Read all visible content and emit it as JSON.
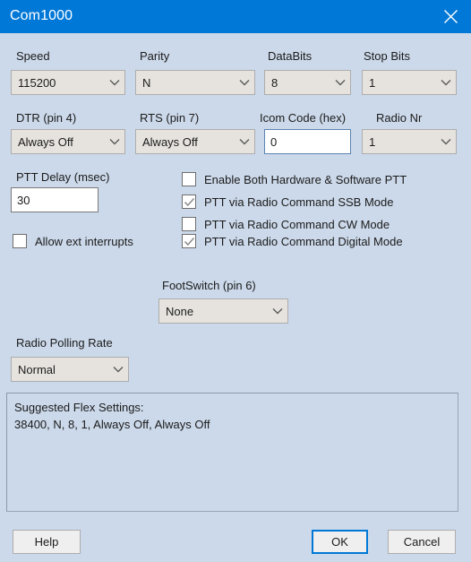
{
  "window": {
    "title": "Com1000",
    "close_icon": "close-icon",
    "titlebar_color": "#0078d7",
    "background_color": "#ccd9ea"
  },
  "fields": {
    "speed": {
      "label": "Speed",
      "value": "115200"
    },
    "parity": {
      "label": "Parity",
      "value": "N"
    },
    "databits": {
      "label": "DataBits",
      "value": "8"
    },
    "stopbits": {
      "label": "Stop Bits",
      "value": "1"
    },
    "dtr": {
      "label": "DTR (pin 4)",
      "value": "Always Off"
    },
    "rts": {
      "label": "RTS (pin 7)",
      "value": "Always Off"
    },
    "icom_code": {
      "label": "Icom Code (hex)",
      "value": "0"
    },
    "radio_nr": {
      "label": "Radio Nr",
      "value": "1"
    },
    "ptt_delay": {
      "label": "PTT Delay  (msec)",
      "value": "30"
    },
    "footswitch": {
      "label": "FootSwitch (pin 6)",
      "value": "None"
    },
    "polling_rate": {
      "label": "Radio Polling Rate",
      "value": "Normal"
    }
  },
  "checkboxes": [
    {
      "label": "Allow ext interrupts",
      "checked": false
    },
    {
      "label": "Enable Both Hardware & Software PTT",
      "checked": false
    },
    {
      "label": "PTT via Radio Command SSB Mode",
      "checked": true
    },
    {
      "label": "PTT via Radio Command CW Mode",
      "checked": false
    },
    {
      "label": "PTT via Radio Command Digital Mode",
      "checked": true
    }
  ],
  "suggested_panel": {
    "line1": "Suggested Flex Settings:",
    "line2": "38400, N, 8, 1, Always Off, Always Off"
  },
  "buttons": {
    "help": "Help",
    "ok": "OK",
    "cancel": "Cancel"
  }
}
